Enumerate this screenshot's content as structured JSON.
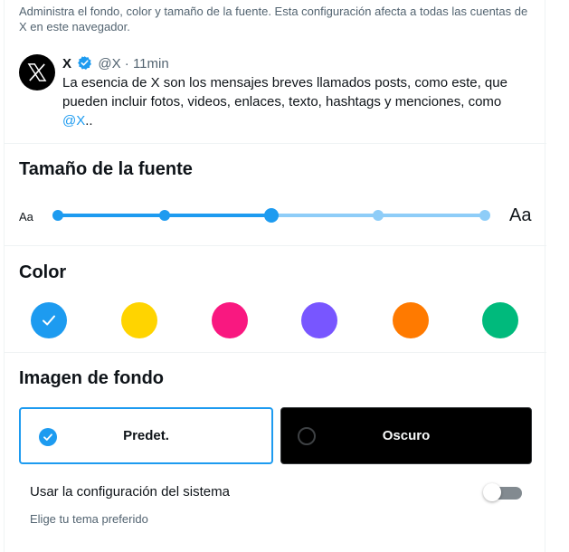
{
  "description": "Administra el fondo, color y tamaño de la fuente. Esta configuración afecta a todas las cuentas de X en este navegador.",
  "post": {
    "name": "X",
    "handle": "@X",
    "separator": "·",
    "time": "11min",
    "text": "La esencia de X son los mensajes breves llamados posts, como este, que pueden incluir fotos, videos, enlaces, texto, hashtags y menciones, como ",
    "mention": "@X",
    "text_end": ".."
  },
  "font_size": {
    "title": "Tamaño de la fuente",
    "small_label": "Aa",
    "large_label": "Aa",
    "levels": 5,
    "selected_index": 2
  },
  "color": {
    "title": "Color",
    "swatches": [
      {
        "name": "blue",
        "hex": "#1d9bf0",
        "selected": true
      },
      {
        "name": "yellow",
        "hex": "#ffd400",
        "selected": false
      },
      {
        "name": "pink",
        "hex": "#f91880",
        "selected": false
      },
      {
        "name": "purple",
        "hex": "#7856ff",
        "selected": false
      },
      {
        "name": "orange",
        "hex": "#ff7a00",
        "selected": false
      },
      {
        "name": "green",
        "hex": "#00ba7c",
        "selected": false
      }
    ]
  },
  "background": {
    "title": "Imagen de fondo",
    "options": [
      {
        "label": "Predet.",
        "selected": true
      },
      {
        "label": "Oscuro",
        "selected": false
      }
    ]
  },
  "system": {
    "label": "Usar la configuración del sistema",
    "sublabel": "Elige tu tema preferido",
    "enabled": false
  },
  "colors": {
    "accent": "#1d9bf0",
    "accent_light": "#8ecdf8",
    "text": "#0f1419",
    "secondary_text": "#536471"
  }
}
